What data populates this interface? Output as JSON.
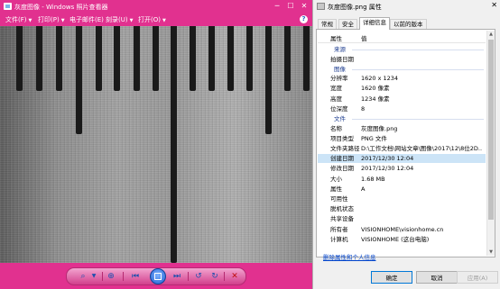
{
  "viewer": {
    "title": "灰度图像 - Windows 照片查看器",
    "menus": [
      {
        "label": "文件(F)"
      },
      {
        "label": "打印(P)"
      },
      {
        "label": "电子邮件(E)"
      },
      {
        "label": "刻录(U)"
      },
      {
        "label": "打开(O)"
      }
    ],
    "window_buttons": {
      "minimize": "─",
      "maximize": "☐",
      "close": "✕"
    },
    "help": "?"
  },
  "properties": {
    "title": "灰度图像.png 属性",
    "tabs": [
      "常规",
      "安全",
      "详细信息",
      "以前的版本"
    ],
    "active_tab": "详细信息",
    "columns": {
      "name": "属性",
      "value": "值"
    },
    "rows": [
      {
        "type": "section",
        "k": "来源",
        "v": ""
      },
      {
        "type": "item",
        "k": "拍摄日期",
        "v": ""
      },
      {
        "type": "section",
        "k": "图像",
        "v": ""
      },
      {
        "type": "item",
        "k": "分辨率",
        "v": "1620 x 1234"
      },
      {
        "type": "item",
        "k": "宽度",
        "v": "1620 像素"
      },
      {
        "type": "item",
        "k": "高度",
        "v": "1234 像素"
      },
      {
        "type": "item",
        "k": "位深度",
        "v": "8"
      },
      {
        "type": "section",
        "k": "文件",
        "v": ""
      },
      {
        "type": "item",
        "k": "名称",
        "v": "灰度图像.png"
      },
      {
        "type": "item",
        "k": "项目类型",
        "v": "PNG 文件"
      },
      {
        "type": "item",
        "k": "文件夹路径",
        "v": "D:\\工作文档\\网站文章\\图像\\2017\\12\\8位2D..."
      },
      {
        "type": "item",
        "k": "创建日期",
        "v": "2017/12/30 12:04",
        "selected": true
      },
      {
        "type": "item",
        "k": "修改日期",
        "v": "2017/12/30 12:04"
      },
      {
        "type": "item",
        "k": "大小",
        "v": "1.68 MB"
      },
      {
        "type": "item",
        "k": "属性",
        "v": "A"
      },
      {
        "type": "item",
        "k": "可用性",
        "v": ""
      },
      {
        "type": "item",
        "k": "脱机状态",
        "v": ""
      },
      {
        "type": "item",
        "k": "共享设备",
        "v": ""
      },
      {
        "type": "item",
        "k": "所有者",
        "v": "VISIONHOME\\visionhome.cn"
      },
      {
        "type": "item",
        "k": "计算机",
        "v": "VISIONHOME (这台电脑)"
      }
    ],
    "remove_link": "删除属性和个人信息",
    "buttons": {
      "ok": "确定",
      "cancel": "取消",
      "apply": "应用(A)"
    },
    "close": "✕"
  }
}
